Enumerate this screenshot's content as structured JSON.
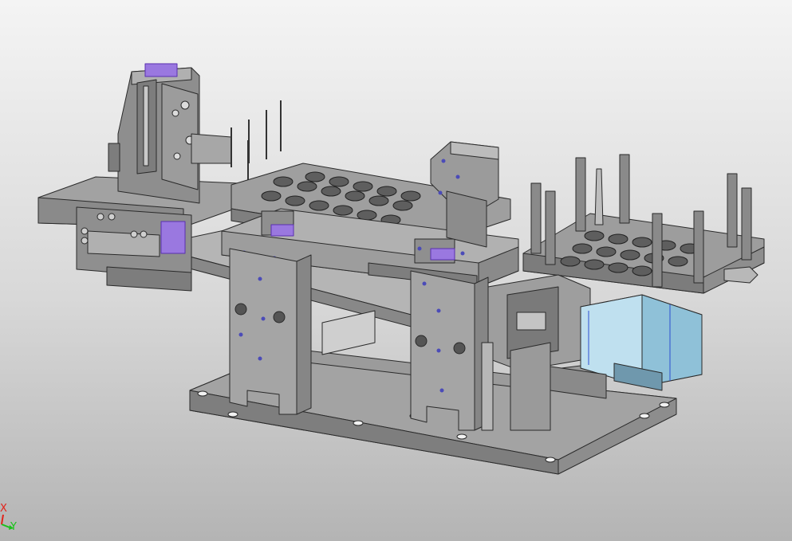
{
  "viewport": {
    "background_top": "#f4f4f4",
    "background_bottom": "#b4b4b4"
  },
  "model": {
    "icon": "cad-assembly-model",
    "steel_color": "#9a9a9a",
    "motor_color": "#a9d2e6",
    "edge_color": "#2a2a2a",
    "highlight_color": "#7b3fe4"
  },
  "triad": {
    "x_label": "X",
    "y_label": "Y",
    "x_color": "#e2231a",
    "y_color": "#1ac21a"
  }
}
